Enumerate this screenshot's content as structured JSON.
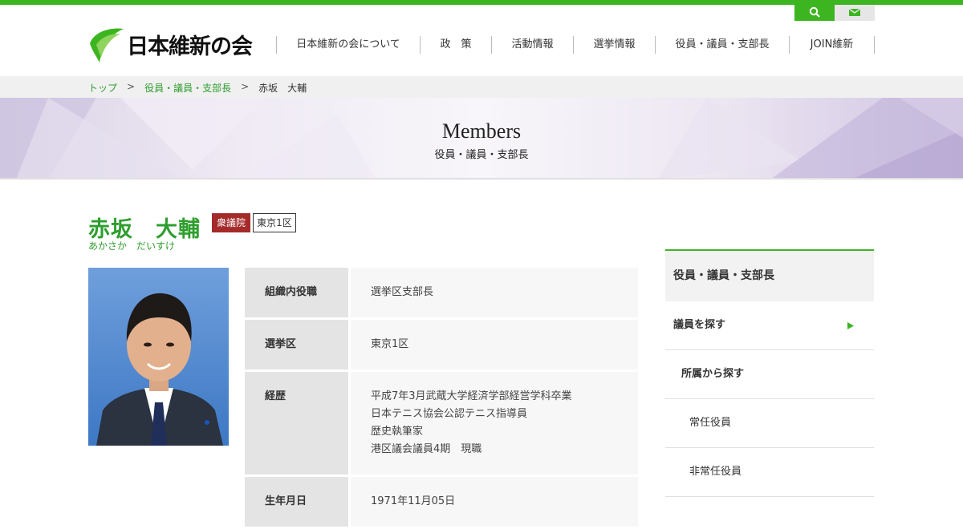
{
  "header": {
    "logo_text": "日本維新の会",
    "search_icon": "search-icon",
    "mail_icon": "mail-icon",
    "accent_color": "#3cb521"
  },
  "nav": {
    "items": [
      "日本維新の会について",
      "政　策",
      "活動情報",
      "選挙情報",
      "役員・議員・支部長",
      "JOIN維新"
    ]
  },
  "breadcrumb": {
    "home": "トップ",
    "sep": ">",
    "section": "役員・議員・支部長",
    "current": "赤坂　大輔"
  },
  "hero": {
    "title": "Members",
    "subtitle": "役員・議員・支部長"
  },
  "member": {
    "name": "赤坂　大輔",
    "kana": "あかさか　だいすけ",
    "house": "衆議院",
    "district": "東京1区",
    "house_badge_color": "#a52a2a"
  },
  "info": {
    "rows": [
      {
        "label": "組織内役職",
        "lines": [
          "選挙区支部長"
        ]
      },
      {
        "label": "選挙区",
        "lines": [
          "東京1区"
        ]
      },
      {
        "label": "経歴",
        "lines": [
          "平成7年3月武蔵大学経済学部経営学科卒業",
          "日本テニス協会公認テニス指導員",
          "歴史執筆家",
          "港区議会議員4期　現職"
        ]
      },
      {
        "label": "生年月日",
        "lines": [
          "1971年11月05日"
        ]
      }
    ]
  },
  "sidebar": {
    "title": "役員・議員・支部長",
    "find_members": "議員を探す",
    "by_affiliation": "所属から探す",
    "standing_officers": "常任役員",
    "non_standing_officers": "非常任役員"
  }
}
